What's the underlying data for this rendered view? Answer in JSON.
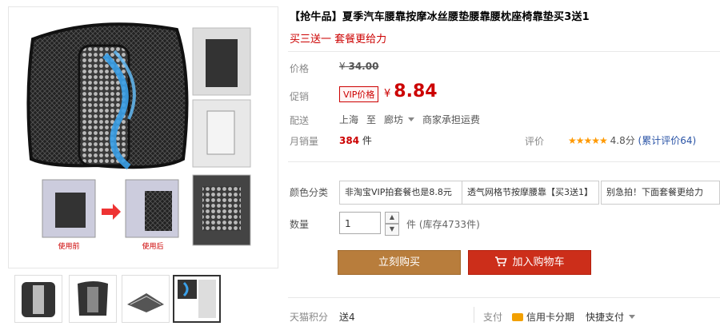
{
  "product": {
    "title": "【抢牛品】夏季汽车腰靠按摩冰丝腰垫腰靠腰枕座椅靠垫买3送1",
    "subtitle": "买三送一 套餐更给力"
  },
  "price": {
    "original_label": "价格",
    "original_currency": "¥",
    "original_value": "34.00",
    "promo_label": "促销",
    "vip_tag": "VIP价格",
    "currency": "¥",
    "value": "8.84"
  },
  "shipping": {
    "label": "配送",
    "from": "上海",
    "to_word": "至",
    "destination": "廊坊",
    "fee_text": "商家承担运费"
  },
  "sales": {
    "label": "月销量",
    "count": "384",
    "unit": "件"
  },
  "rating": {
    "label": "评价",
    "stars": "★★★★★",
    "score": "4.8分",
    "reviews_link": "(累计评价64)"
  },
  "options": {
    "label": "颜色分类",
    "items": [
      "非淘宝VIP拍套餐也是8.8元",
      "透气网格节按摩腰靠【买3送1】",
      "别急拍！下面套餐更给力"
    ]
  },
  "quantity": {
    "label": "数量",
    "value": "1",
    "unit": "件",
    "stock_text": "(库存4733件)"
  },
  "actions": {
    "buy_now": "立刻购买",
    "add_to_cart": "加入购物车"
  },
  "bottom": {
    "points_label": "天猫积分",
    "points_value": "送4",
    "pay_label": "支付",
    "installment": "信用卡分期",
    "quick_pay": "快捷支付"
  },
  "gallery": {
    "before_label": "使用前",
    "after_label": "使用后"
  },
  "colors": {
    "accent_red": "#cc0000",
    "buy_button": "#b87d3c",
    "cart_button": "#cc2e1a",
    "link_blue": "#2953a6"
  }
}
